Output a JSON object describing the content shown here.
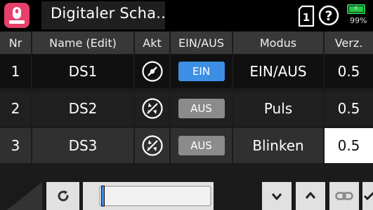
{
  "titlebar": {
    "title": "Digitaler Scha..",
    "app_icon": "switch-app-icon",
    "card_icon": "model-card-icon",
    "card_number": "1",
    "help_icon": "help-icon",
    "battery_percent": "99%",
    "battery_level": 0.99
  },
  "table": {
    "headers": {
      "nr": "Nr",
      "name": "Name (Edit)",
      "act": "Akt",
      "onoff": "EIN/AUS",
      "mode": "Modus",
      "delay": "Verz."
    },
    "rows": [
      {
        "nr": "1",
        "name": "DS1",
        "act_icon": "switch-inactive-icon",
        "state": "EIN",
        "mode": "EIN/AUS",
        "delay": "0.5"
      },
      {
        "nr": "2",
        "name": "DS2",
        "act_icon": "switch-blocked-icon",
        "state": "AUS",
        "mode": "Puls",
        "delay": "0.5"
      },
      {
        "nr": "3",
        "name": "DS3",
        "act_icon": "switch-blocked-icon",
        "state": "AUS",
        "mode": "Blinken",
        "delay": "0.5"
      }
    ]
  },
  "toolbar": {
    "corner_icon": "corner-triangle-icon",
    "reset_icon": "reset-icon",
    "slider_value": 0.0,
    "down_icon": "chevron-down-icon",
    "up_icon": "chevron-up-icon",
    "link_icon": "link-icon",
    "confirm_icon": "checkmark-icon"
  },
  "colors": {
    "accent_blue": "#3d8fe5",
    "app_pink": "#e5416a",
    "battery_green": "#22c84a",
    "badge_gray": "#8b8b8b"
  }
}
